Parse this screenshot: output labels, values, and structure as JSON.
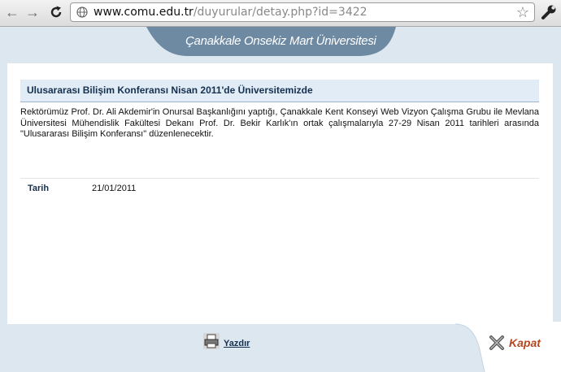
{
  "browser": {
    "url_host": "www.comu.edu.tr",
    "url_path": "/duyurular/detay.php?id=3422",
    "back_icon": "arrow-left-icon",
    "forward_icon": "arrow-right-icon",
    "reload_icon": "reload-icon",
    "page_icon": "globe-icon",
    "bookmark_icon": "star-icon",
    "settings_icon": "wrench-icon"
  },
  "header": {
    "university_name": "Çanakkale Onsekiz Mart Üniversitesi"
  },
  "announcement": {
    "title": "Ulusararası Bilişim Konferansı Nisan 2011'de Üniversitemizde",
    "body": "Rektörümüz Prof. Dr. Ali Akdemir'in Onursal Başkanlığını yaptığı, Çanakkale Kent Konseyi Web Vizyon Çalışma Grubu ile Mevlana Üniversitesi Mühendislik Fakültesi Dekanı Prof. Dr. Bekir Karlık'ın ortak çalışmalarıyla 27-29 Nisan 2011 tarihleri arasında \"Ulusararası Bilişim Konferansı\" düzenlenecektir.",
    "date_label": "Tarih",
    "date_value": "21/01/2011"
  },
  "footer": {
    "print_label": "Yazdır",
    "close_label": "Kapat"
  },
  "colors": {
    "page_background": "#dce7f0",
    "banner": "#6e8aa3",
    "title_bar": "#e1ecf6",
    "heading_text": "#15304f",
    "close_text": "#b5471f"
  }
}
